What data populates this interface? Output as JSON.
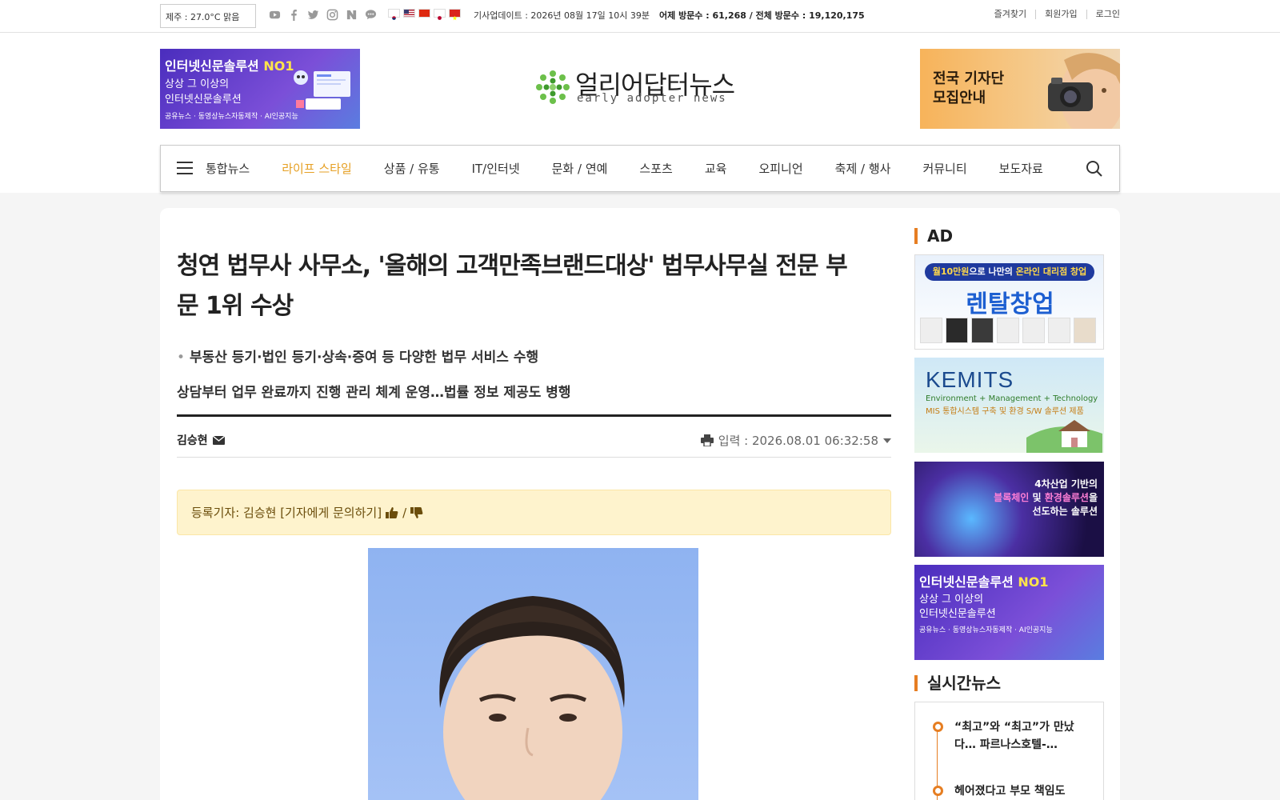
{
  "topbar": {
    "weather": "제주 : 27.0°C 맑음",
    "sns_icons": [
      "youtube-icon",
      "facebook-icon",
      "twitter-icon",
      "instagram-icon",
      "naver-icon",
      "talk-icon"
    ],
    "flags": [
      "kr-flag",
      "us-flag",
      "cn-flag",
      "jp-flag",
      "vn-flag"
    ],
    "update": "기사업데이트 : 2026년 08월 17일 10시 39분",
    "visits": "어제 방문수 : 61,268 / 전체 방문수 : 19,120,175",
    "links": [
      "즐겨찾기",
      "회원가입",
      "로그인"
    ]
  },
  "header": {
    "banner_left": {
      "line1": "인터넷신문솔루션",
      "line1_em": "NO1",
      "line2a": "상상 그 이상의",
      "line2b": "인터넷신문솔루션",
      "line3": "공유뉴스 · 동영상뉴스자동제작 · AI인공지능"
    },
    "logo_ko": "얼리어답터뉴스",
    "logo_en": "early adopter news",
    "banner_right": {
      "line1": "전국 기자단",
      "line2": "모집안내"
    }
  },
  "nav": {
    "items": [
      "통합뉴스",
      "라이프 스타일",
      "상품 / 유통",
      "IT/인터넷",
      "문화 / 연예",
      "스포츠",
      "교육",
      "오피니언",
      "축제 / 행사",
      "커뮤니티",
      "보도자료"
    ],
    "active": "라이프 스타일"
  },
  "article": {
    "title": "청연 법무사 사무소, '올해의 고객만족브랜드대상' 법무사무실 전문 부문 1위 수상",
    "subtitle1": "부동산 등기·법인 등기·상속·증여 등 다양한 법무 서비스 수행",
    "subtitle2": "상담부터 업무 완료까지 진행 관리 체계 운영…법률 정보 제공도 병행",
    "author": "김승현",
    "date": "입력 : 2026.08.01 06:32:58",
    "reporter_box": "등록기자: 김승현 [기자에게 문의하기]",
    "reporter_sep": "/"
  },
  "sidebar": {
    "ad_title": "AD",
    "ad1": {
      "pill_a": "월10만원",
      "pill_b": "으로 나만의 ",
      "pill_c": "온라인 대리점 창업",
      "big": "렌탈창업"
    },
    "ad2": {
      "brand": "KEMITS",
      "line1": "Environment + Management + Technology",
      "line2": "MIS 통합시스템 구축 및 환경 S/W 솔루션 제품"
    },
    "ad3": {
      "line1": "4차산업 기반의",
      "line2a": "블록체인",
      "line2b": " 및 ",
      "line2c": "환경솔루션",
      "line2d": "을",
      "line3": "선도하는 솔루션"
    },
    "ad4": {
      "line1": "인터넷신문솔루션",
      "line1_em": "NO1",
      "line2a": "상상 그 이상의",
      "line2b": "인터넷신문솔루션",
      "line3": "공유뉴스 · 동영상뉴스자동제작 · AI인공지능"
    },
    "live_title": "실시간뉴스",
    "live_news": [
      "“최고”와 “최고”가 만났다… 파르나스호텔-…",
      "헤어졌다고 부모 책임도"
    ]
  },
  "colors": {
    "accent": "#e6a024",
    "orange": "#e67e22",
    "notice_bg": "#fef3cd"
  }
}
